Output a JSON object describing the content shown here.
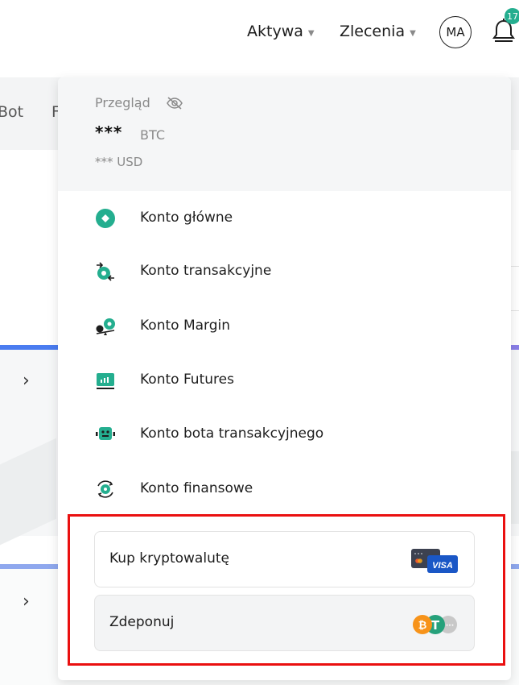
{
  "header": {
    "nav": [
      {
        "label": "Aktywa"
      },
      {
        "label": "Zlecenia"
      }
    ],
    "avatar": "MA",
    "notifications_count": "17"
  },
  "background": {
    "tabs": [
      "Bot",
      "F"
    ]
  },
  "overview": {
    "title": "Przegląd",
    "amount": "***",
    "unit": "BTC",
    "usd": "*** USD"
  },
  "accounts": [
    {
      "label": "Konto główne",
      "icon": "main-account-icon"
    },
    {
      "label": "Konto transakcyjne",
      "icon": "trading-account-icon"
    },
    {
      "label": "Konto Margin",
      "icon": "margin-account-icon"
    },
    {
      "label": "Konto Futures",
      "icon": "futures-account-icon"
    },
    {
      "label": "Konto bota transakcyjnego",
      "icon": "bot-account-icon"
    },
    {
      "label": "Konto finansowe",
      "icon": "financial-account-icon"
    }
  ],
  "actions": {
    "buy_label": "Kup kryptowalutę",
    "deposit_label": "Zdeponuj",
    "card_brand": "VISA",
    "coin_btc": "₿",
    "coin_usdt": "T",
    "coin_more": "···"
  },
  "colors": {
    "accent": "#24ae8f",
    "highlight": "#ea1010"
  }
}
